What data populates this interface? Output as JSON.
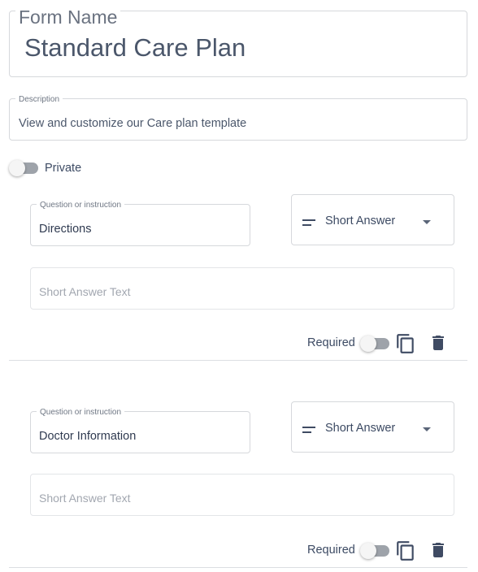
{
  "form": {
    "name_legend": "Form Name",
    "name_value": "Standard Care Plan",
    "description_legend": "Description",
    "description_value": "View and customize our Care plan template",
    "private_label": "Private"
  },
  "questions": [
    {
      "legend": "Question or instruction",
      "value": "Directions",
      "type_label": "Short Answer",
      "answer_placeholder": "Short Answer Text",
      "required_label": "Required"
    },
    {
      "legend": "Question or instruction",
      "value": "Doctor Information",
      "type_label": "Short Answer",
      "answer_placeholder": "Short Answer Text",
      "required_label": "Required"
    }
  ],
  "icons": {
    "type": "short-text-icon",
    "dropdown": "caret-down-icon",
    "copy": "copy-icon",
    "delete": "trash-icon"
  },
  "colors": {
    "text": "#3c4a63",
    "border": "#d6d8dc",
    "toggle_track": "#9ea3aa",
    "icon": "#3f4b63"
  }
}
